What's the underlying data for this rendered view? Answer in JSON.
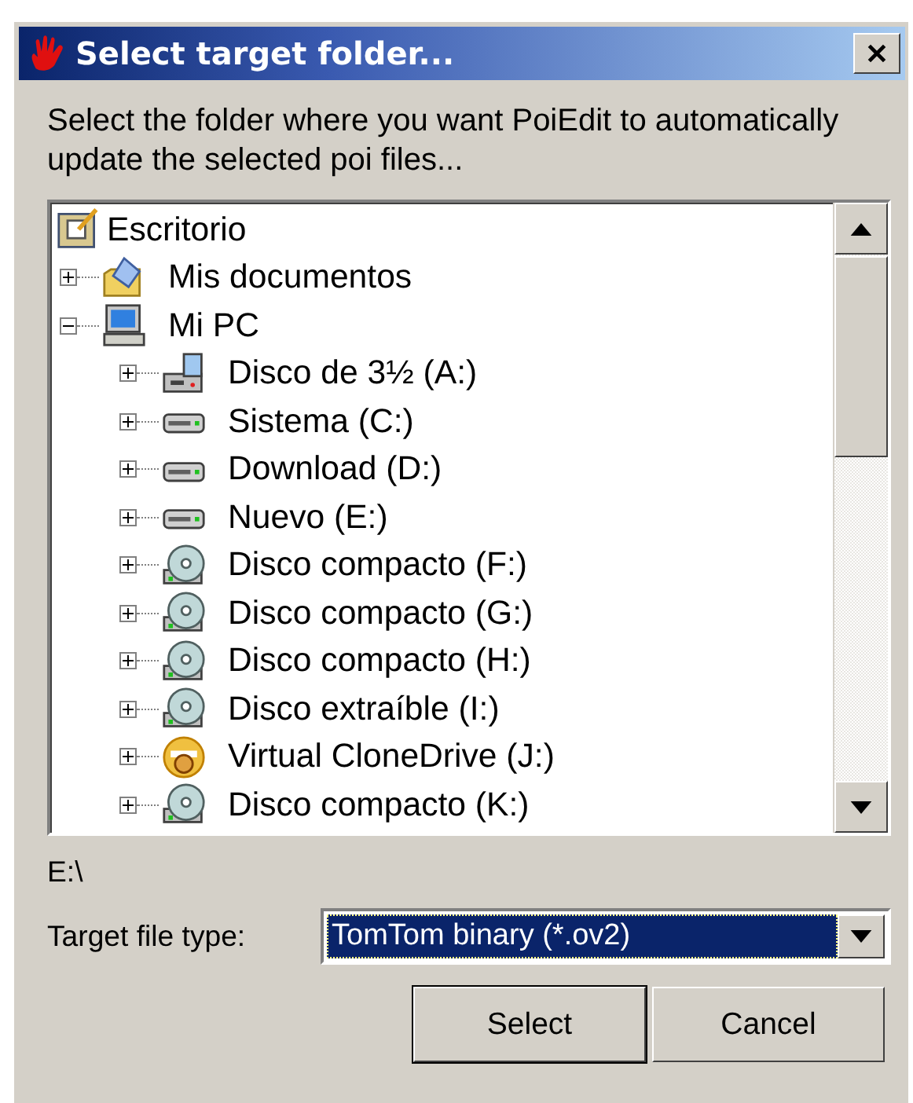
{
  "window": {
    "title": "Select target folder..."
  },
  "prompt": "Select the folder where you want PoiEdit to automatically update the selected poi files...",
  "tree": [
    {
      "label": "Escritorio",
      "kind": "desktop",
      "children": [
        {
          "label": "Mis documentos",
          "kind": "documents",
          "expanded": false
        },
        {
          "label": "Mi PC",
          "kind": "computer",
          "expanded": true,
          "children": [
            {
              "label": "Disco de 3½ (A:)",
              "kind": "floppy",
              "expanded": false
            },
            {
              "label": "Sistema (C:)",
              "kind": "harddisk",
              "expanded": false
            },
            {
              "label": "Download (D:)",
              "kind": "harddisk",
              "expanded": false
            },
            {
              "label": "Nuevo (E:)",
              "kind": "harddisk",
              "expanded": false
            },
            {
              "label": "Disco compacto (F:)",
              "kind": "cd",
              "expanded": false
            },
            {
              "label": "Disco compacto (G:)",
              "kind": "cd",
              "expanded": false
            },
            {
              "label": "Disco compacto (H:)",
              "kind": "cd",
              "expanded": false
            },
            {
              "label": "Disco extraíble (I:)",
              "kind": "cd",
              "expanded": false
            },
            {
              "label": "Virtual CloneDrive (J:)",
              "kind": "clone",
              "expanded": false
            },
            {
              "label": "Disco compacto (K:)",
              "kind": "cd",
              "expanded": false
            }
          ]
        }
      ]
    }
  ],
  "path": "E:\\",
  "file_type": {
    "label": "Target file type:",
    "value": "TomTom binary (*.ov2)",
    "focused": true
  },
  "buttons": [
    {
      "label": "Select",
      "default": true
    },
    {
      "label": "Cancel",
      "default": false
    }
  ]
}
